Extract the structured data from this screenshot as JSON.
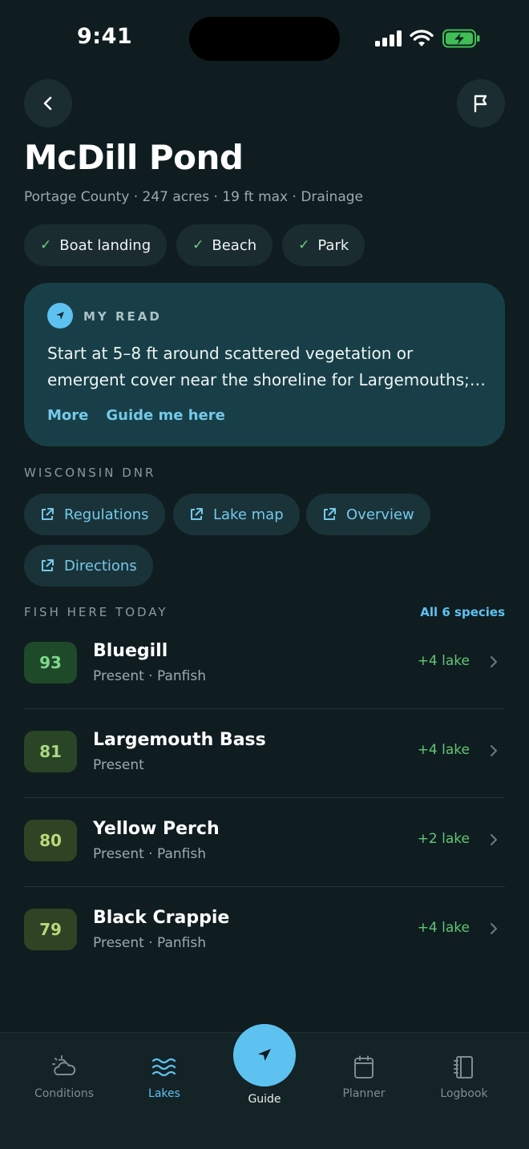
{
  "status": {
    "time": "9:41"
  },
  "header": {
    "title": "McDill Pond",
    "subtitle": "Portage County · 247 acres · 19 ft max · Drainage",
    "amenities": [
      "Boat landing",
      "Beach",
      "Park"
    ]
  },
  "my_read": {
    "label": "MY READ",
    "text_line1": "Start at 5–8 ft around scattered vegetation or",
    "text_line2": "emergent cover near the shoreline for Largemouths; the north end has the best structure",
    "more": "More",
    "guide": "Guide me here"
  },
  "dnr": {
    "label": "WISCONSIN DNR",
    "links": [
      "Regulations",
      "Lake map",
      "Overview",
      "Directions"
    ]
  },
  "fish": {
    "label": "FISH HERE TODAY",
    "all_link": "All 6 species",
    "items": [
      {
        "score": "93",
        "name": "Bluegill",
        "meta": "Present · Panfish",
        "delta": "+4 lake",
        "badge_bg": "#1f4a2a",
        "badge_fg": "#7ed88d"
      },
      {
        "score": "81",
        "name": "Largemouth Bass",
        "meta": "Present",
        "delta": "+4 lake",
        "badge_bg": "#2a4426",
        "badge_fg": "#a7d982"
      },
      {
        "score": "80",
        "name": "Yellow Perch",
        "meta": "Present · Panfish",
        "delta": "+2 lake",
        "badge_bg": "#2f4424",
        "badge_fg": "#b8d97a"
      },
      {
        "score": "79",
        "name": "Black Crappie",
        "meta": "Present · Panfish",
        "delta": "+4 lake",
        "badge_bg": "#2f4424",
        "badge_fg": "#b8d97a"
      }
    ]
  },
  "tabs": {
    "conditions": "Conditions",
    "lakes": "Lakes",
    "guide": "Guide",
    "planner": "Planner",
    "logbook": "Logbook"
  },
  "colors": {
    "accent": "#5ec2f0",
    "background": "#0f1d20",
    "card": "#183f47",
    "success": "#62c476"
  }
}
